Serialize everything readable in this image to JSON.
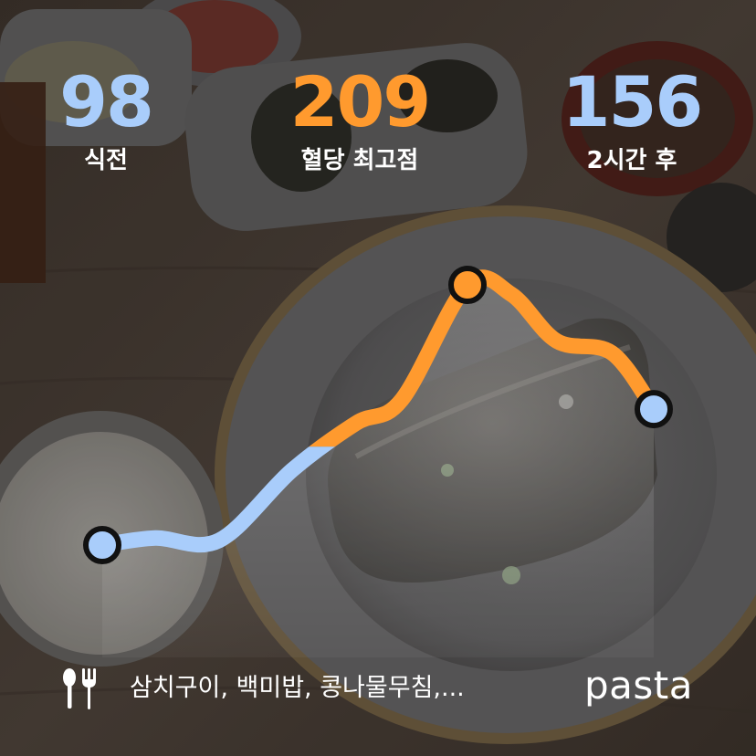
{
  "stats": {
    "before": {
      "value": "98",
      "label": "식전"
    },
    "peak": {
      "value": "209",
      "label": "혈당 최고점"
    },
    "after": {
      "value": "156",
      "label": "2시간 후"
    }
  },
  "foods": "삼치구이, 백미밥, 콩나물무침,...",
  "logo": "pasta",
  "icons": {
    "meal": "utensils-icon"
  },
  "colors": {
    "normal": "#a9cdfb",
    "peak": "#ff9a2e",
    "text": "#ffffff",
    "marker_outline": "#111111"
  },
  "chart_data": {
    "type": "line",
    "series": [
      {
        "values": [
          98,
          101,
          100,
          130,
          150,
          160,
          209,
          205,
          185,
          180,
          156
        ]
      }
    ],
    "threshold": 140
  }
}
